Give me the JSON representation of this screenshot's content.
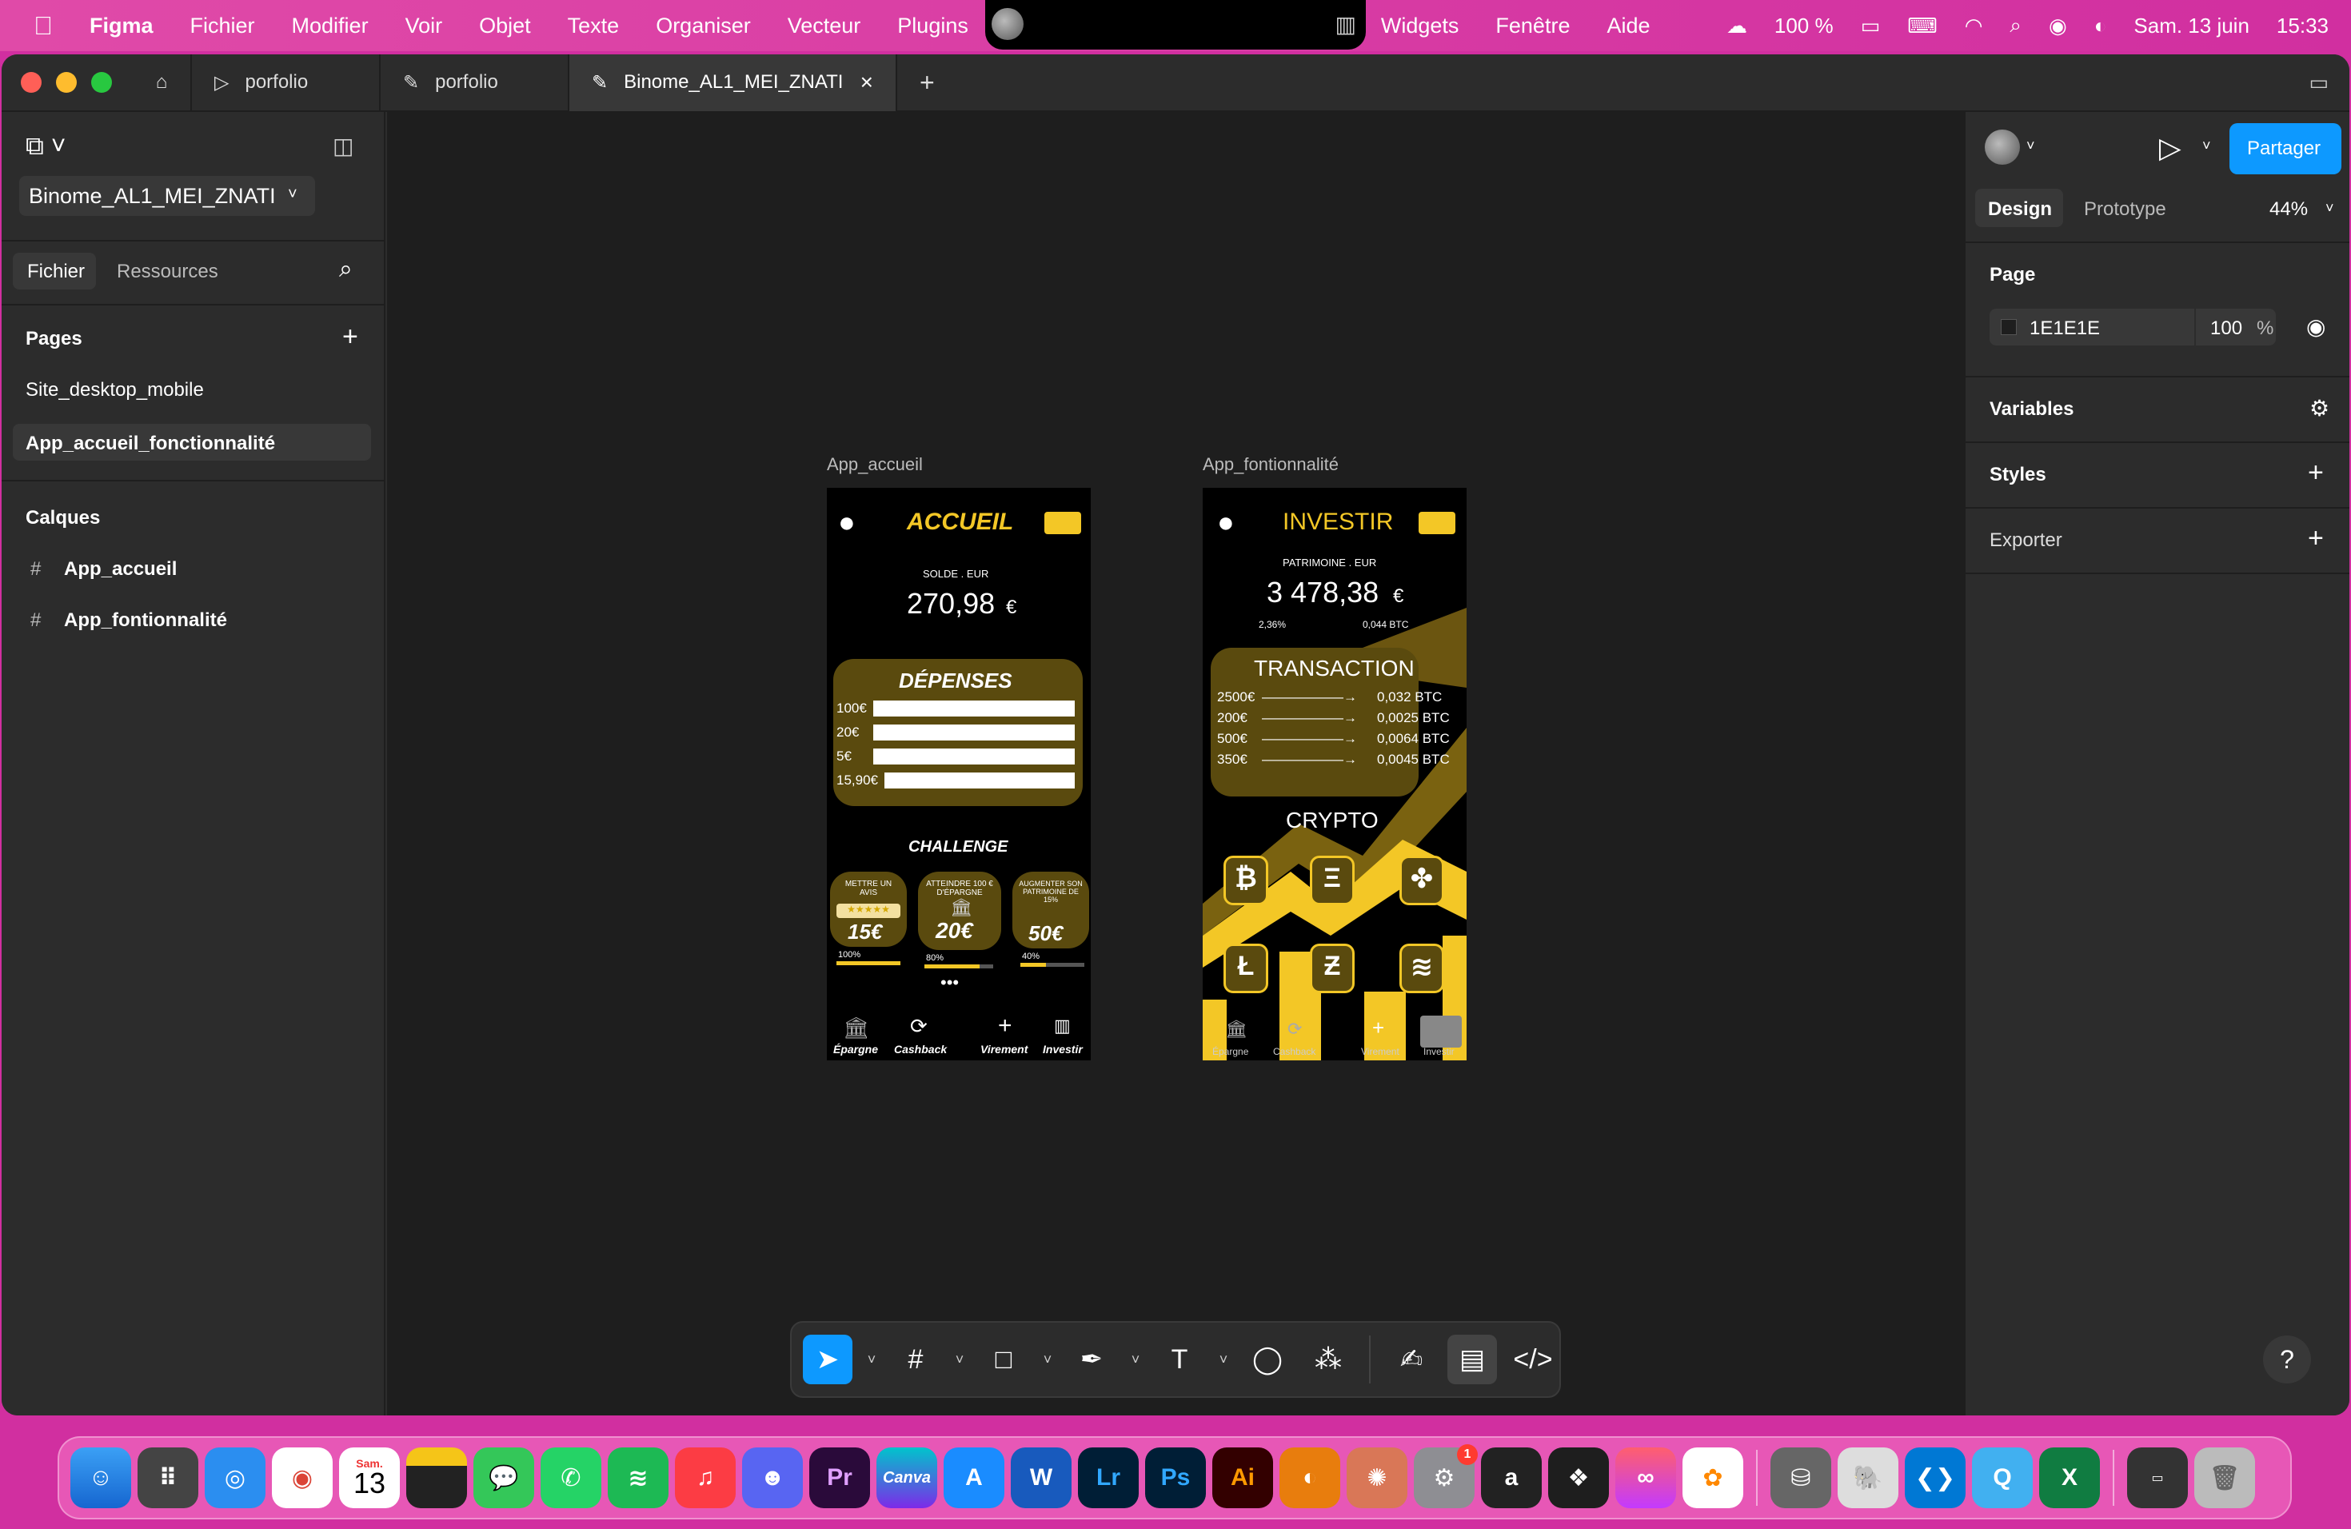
{
  "menubar": {
    "app": "Figma",
    "items": [
      "Fichier",
      "Modifier",
      "Voir",
      "Objet",
      "Texte",
      "Organiser",
      "Vecteur",
      "Plugins",
      "Widgets",
      "Fenêtre",
      "Aide"
    ],
    "battery": "100 %",
    "date": "Sam. 13 juin",
    "time": "15:33"
  },
  "tabs": [
    {
      "label": "porfolio"
    },
    {
      "label": "porfolio"
    },
    {
      "label": "Binome_AL1_MEI_ZNATI"
    }
  ],
  "left": {
    "file_name": "Binome_AL1_MEI_ZNATI",
    "tab_file": "Fichier",
    "tab_resources": "Ressources",
    "pages_title": "Pages",
    "pages": [
      "Site_desktop_mobile",
      "App_accueil_fonctionnalité"
    ],
    "layers_title": "Calques",
    "layers": [
      "App_accueil",
      "App_fontionnalité"
    ]
  },
  "right": {
    "share": "Partager",
    "tab_design": "Design",
    "tab_prototype": "Prototype",
    "zoom": "44%",
    "page_title": "Page",
    "page_color": "1E1E1E",
    "page_opacity": "100",
    "percent": "%",
    "variables": "Variables",
    "styles": "Styles",
    "export": "Exporter"
  },
  "frame1": {
    "name": "App_accueil",
    "title": "ACCUEIL",
    "balance_label": "SOLDE . EUR",
    "balance": "270,98",
    "currency": "€",
    "expenses_title": "DÉPENSES",
    "expenses": [
      {
        "label": "100€",
        "fill": 1
      },
      {
        "label": "20€",
        "fill": 1
      },
      {
        "label": "5€",
        "fill": 1
      },
      {
        "label": "15,90€",
        "fill": 1
      }
    ],
    "challenge_title": "CHALLENGE",
    "challenges": [
      {
        "text": "METTRE UN AVIS",
        "amount": "15€",
        "progress": "100%",
        "pct": 100
      },
      {
        "text": "ATTEINDRE 100 € D'ÉPARGNE",
        "amount": "20€",
        "progress": "80%",
        "pct": 80
      },
      {
        "text": "AUGMENTER SON PATRIMOINE DE 15%",
        "amount": "50€",
        "progress": "40%",
        "pct": 40
      }
    ],
    "dots": "•••",
    "nav": [
      "Épargne",
      "Cashback",
      "Virement",
      "Investir"
    ]
  },
  "frame2": {
    "name": "App_fontionnalité",
    "title": "INVESTIR",
    "wealth_label": "PATRIMOINE . EUR",
    "wealth": "3 478,38",
    "currency": "€",
    "change": "2,36%",
    "btc": "0,044 BTC",
    "transaction_title": "TRANSACTION",
    "transactions": [
      {
        "eur": "2500€",
        "btc": "0,032 BTC"
      },
      {
        "eur": "200€",
        "btc": "0,0025 BTC"
      },
      {
        "eur": "500€",
        "btc": "0,0064 BTC"
      },
      {
        "eur": "350€",
        "btc": "0,0045 BTC"
      }
    ],
    "crypto_title": "CRYPTO",
    "coins": [
      "₿",
      "Ξ",
      "✤",
      "Ł",
      "Ƶ",
      "≋"
    ],
    "nav": [
      "Épargne",
      "Cashback",
      "Virement",
      "Investir"
    ]
  },
  "dock": {
    "calendar_day": "13",
    "calendar_month": "Sam.",
    "badge": "1",
    "apps": [
      "Pr",
      "Canva",
      "Lr",
      "Ps",
      "Ai",
      "a"
    ]
  },
  "colors": {
    "accent": "#0d99ff",
    "gold": "#f3c726",
    "panel": "#2c2c2c",
    "canvas": "#1e1e1e"
  }
}
